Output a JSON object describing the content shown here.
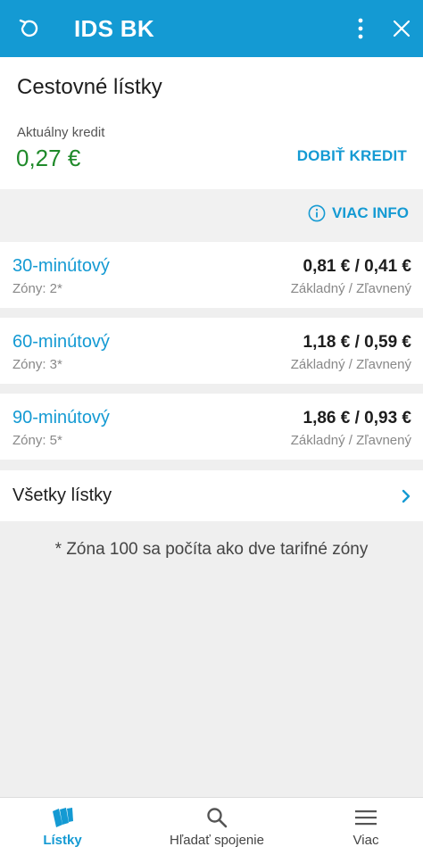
{
  "appbar": {
    "title": "IDS BK",
    "icons": [
      "refresh-icon",
      "more-vert-icon",
      "close-icon"
    ]
  },
  "credit": {
    "section_title": "Cestovné lístky",
    "label": "Aktuálny kredit",
    "value": "0,27 €",
    "topup_label": "DOBIŤ KREDIT"
  },
  "info": {
    "label": "VIAC INFO",
    "icon": "info-icon"
  },
  "tickets": [
    {
      "name": "30-minútový",
      "zones": "Zóny: 2*",
      "price": "0,81 € / 0,41 €",
      "type": "Základný / Zľavnený"
    },
    {
      "name": "60-minútový",
      "zones": "Zóny: 3*",
      "price": "1,18 € / 0,59 €",
      "type": "Základný / Zľavnený"
    },
    {
      "name": "90-minútový",
      "zones": "Zóny: 5*",
      "price": "1,86 € / 0,93 €",
      "type": "Základný / Zľavnený"
    }
  ],
  "all_tickets": {
    "label": "Všetky lístky",
    "icon": "chevron-right-icon"
  },
  "note": "* Zóna 100 sa počíta ako dve tarifné zóny",
  "bottom_nav": [
    {
      "label": "Lístky",
      "icon": "tickets-icon",
      "active": true
    },
    {
      "label": "Hľadať spojenie",
      "icon": "search-icon",
      "active": false
    },
    {
      "label": "Viac",
      "icon": "menu-icon",
      "active": false
    }
  ],
  "colors": {
    "primary": "#149ad3",
    "credit_green": "#1f8a2a",
    "background": "#efefef"
  }
}
